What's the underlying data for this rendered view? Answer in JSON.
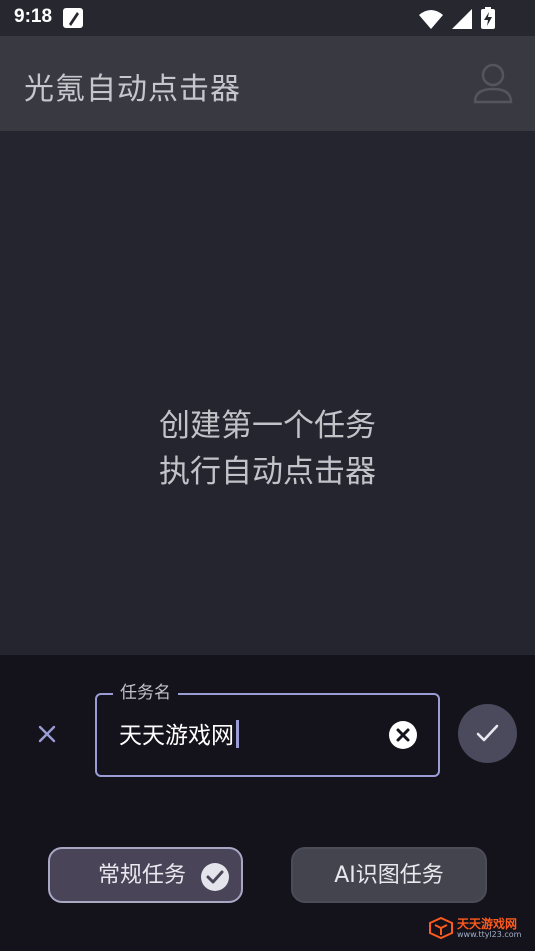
{
  "status_bar": {
    "time": "9:18",
    "icons": [
      "edit-note-icon",
      "wifi-icon",
      "signal-icon",
      "battery-charging-icon"
    ]
  },
  "app_bar": {
    "title": "光氪自动点击器",
    "profile_icon": "person-outline-icon"
  },
  "main": {
    "empty_line1": "创建第一个任务",
    "empty_line2": "执行自动点击器"
  },
  "task_sheet": {
    "field_label": "任务名",
    "field_value": "天天游戏网",
    "cancel_icon": "close-icon",
    "clear_icon": "clear-circle-icon",
    "confirm_icon": "check-icon",
    "type_regular_label": "常规任务",
    "type_ai_label": "AI识图任务",
    "selected_type": "常规任务"
  },
  "watermark": {
    "name": "天天游戏网",
    "url": "www.ttyl23.com"
  },
  "colors": {
    "background": "#25252f",
    "app_bar": "#393942",
    "sheet": "#14121a",
    "accent": "#9a9cd6"
  }
}
